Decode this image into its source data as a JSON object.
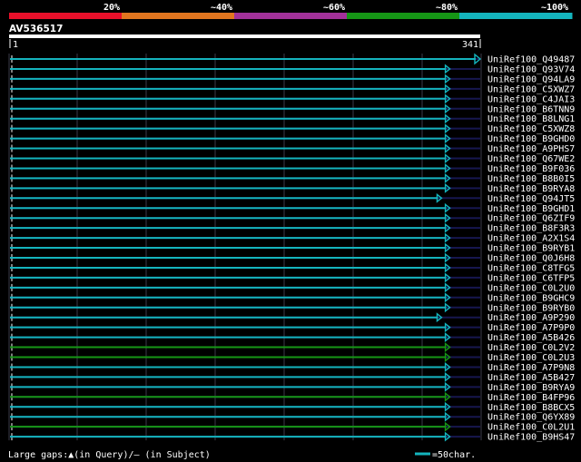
{
  "chart_data": {
    "type": "alignment-overview",
    "query_id": "AV536517",
    "query_range": [
      "1",
      "341"
    ],
    "query_length": 341,
    "identity_scale": {
      "labels": [
        "20%",
        "~40%",
        "~60%",
        "~80%",
        "~100%"
      ],
      "colors": [
        "#e8102a",
        "#e2761f",
        "#a23199",
        "#169616",
        "#14b4bd"
      ]
    },
    "grid": true,
    "hits": [
      {
        "name": "UniRef100_Q49487",
        "end": 341,
        "identity_color": "#14b4bd",
        "arrow": "large"
      },
      {
        "name": "UniRef100_Q93V74",
        "end": 319,
        "identity_color": "#14b4bd",
        "arrow": "normal"
      },
      {
        "name": "UniRef100_Q94LA9",
        "end": 319,
        "identity_color": "#14b4bd",
        "arrow": "normal"
      },
      {
        "name": "UniRef100_C5XWZ7",
        "end": 319,
        "identity_color": "#14b4bd",
        "arrow": "normal"
      },
      {
        "name": "UniRef100_C4JAI3",
        "end": 319,
        "identity_color": "#14b4bd",
        "arrow": "normal"
      },
      {
        "name": "UniRef100_B6TNN9",
        "end": 319,
        "identity_color": "#14b4bd",
        "arrow": "normal"
      },
      {
        "name": "UniRef100_B8LNG1",
        "end": 319,
        "identity_color": "#14b4bd",
        "arrow": "normal"
      },
      {
        "name": "UniRef100_C5XWZ8",
        "end": 319,
        "identity_color": "#14b4bd",
        "arrow": "normal"
      },
      {
        "name": "UniRef100_B9GHD0",
        "end": 319,
        "identity_color": "#14b4bd",
        "arrow": "normal"
      },
      {
        "name": "UniRef100_A9PHS7",
        "end": 319,
        "identity_color": "#14b4bd",
        "arrow": "normal"
      },
      {
        "name": "UniRef100_Q67WE2",
        "end": 319,
        "identity_color": "#14b4bd",
        "arrow": "normal"
      },
      {
        "name": "UniRef100_B9F036",
        "end": 319,
        "identity_color": "#14b4bd",
        "arrow": "normal"
      },
      {
        "name": "UniRef100_B8B0I5",
        "end": 319,
        "identity_color": "#14b4bd",
        "arrow": "normal"
      },
      {
        "name": "UniRef100_B9RYA8",
        "end": 319,
        "identity_color": "#14b4bd",
        "arrow": "normal"
      },
      {
        "name": "UniRef100_Q94JT5",
        "end": 313,
        "identity_color": "#14b4bd",
        "arrow": "normal"
      },
      {
        "name": "UniRef100_B9GHD1",
        "end": 319,
        "identity_color": "#14b4bd",
        "arrow": "normal"
      },
      {
        "name": "UniRef100_Q6ZIF9",
        "end": 319,
        "identity_color": "#14b4bd",
        "arrow": "normal"
      },
      {
        "name": "UniRef100_B8F3R3",
        "end": 319,
        "identity_color": "#14b4bd",
        "arrow": "normal"
      },
      {
        "name": "UniRef100_A2X1S4",
        "end": 319,
        "identity_color": "#14b4bd",
        "arrow": "normal"
      },
      {
        "name": "UniRef100_B9RYB1",
        "end": 319,
        "identity_color": "#14b4bd",
        "arrow": "normal"
      },
      {
        "name": "UniRef100_Q0J6H8",
        "end": 319,
        "identity_color": "#14b4bd",
        "arrow": "normal"
      },
      {
        "name": "UniRef100_C8TFG5",
        "end": 319,
        "identity_color": "#14b4bd",
        "arrow": "normal"
      },
      {
        "name": "UniRef100_C6TFP5",
        "end": 319,
        "identity_color": "#14b4bd",
        "arrow": "normal"
      },
      {
        "name": "UniRef100_C0L2U0",
        "end": 319,
        "identity_color": "#14b4bd",
        "arrow": "normal"
      },
      {
        "name": "UniRef100_B9GHC9",
        "end": 319,
        "identity_color": "#14b4bd",
        "arrow": "normal"
      },
      {
        "name": "UniRef100_B9RYB0",
        "end": 319,
        "identity_color": "#14b4bd",
        "arrow": "normal"
      },
      {
        "name": "UniRef100_A9P290",
        "end": 313,
        "identity_color": "#14b4bd",
        "arrow": "normal"
      },
      {
        "name": "UniRef100_A7P9P0",
        "end": 319,
        "identity_color": "#14b4bd",
        "arrow": "normal"
      },
      {
        "name": "UniRef100_A5B426",
        "end": 319,
        "identity_color": "#14b4bd",
        "arrow": "normal"
      },
      {
        "name": "UniRef100_C0L2V2",
        "end": 319,
        "identity_color": "#169616",
        "arrow": "normal"
      },
      {
        "name": "UniRef100_C0L2U3",
        "end": 319,
        "identity_color": "#169616",
        "arrow": "normal"
      },
      {
        "name": "UniRef100_A7P9N8",
        "end": 319,
        "identity_color": "#14b4bd",
        "arrow": "normal"
      },
      {
        "name": "UniRef100_A5B427",
        "end": 319,
        "identity_color": "#14b4bd",
        "arrow": "normal"
      },
      {
        "name": "UniRef100_B9RYA9",
        "end": 319,
        "identity_color": "#14b4bd",
        "arrow": "normal"
      },
      {
        "name": "UniRef100_B4FP96",
        "end": 319,
        "identity_color": "#169616",
        "arrow": "normal"
      },
      {
        "name": "UniRef100_B8BCX5",
        "end": 319,
        "identity_color": "#14b4bd",
        "arrow": "normal"
      },
      {
        "name": "UniRef100_Q6YX89",
        "end": 319,
        "identity_color": "#14b4bd",
        "arrow": "normal"
      },
      {
        "name": "UniRef100_C0L2U1",
        "end": 319,
        "identity_color": "#169616",
        "arrow": "normal"
      },
      {
        "name": "UniRef100_B9HS47",
        "end": 319,
        "identity_color": "#14b4bd",
        "arrow": "normal"
      }
    ],
    "footer": {
      "gaps_label": "Large gaps:",
      "query_symbol": "▲",
      "query_text": "(in Query)/",
      "subject_symbol": "–",
      "subject_text": " (in Subject)",
      "scale_label": "=50char."
    }
  }
}
